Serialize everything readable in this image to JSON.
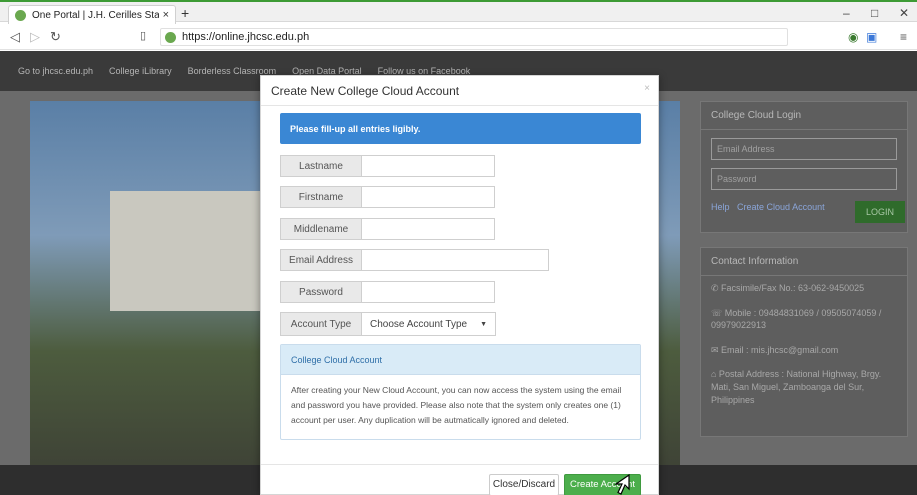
{
  "browser": {
    "tab_title": "One Portal | J.H. Cerilles State Colle",
    "tab_close": "×",
    "new_tab": "+",
    "window_minimize": "–",
    "window_restore": "□",
    "window_close": "✕",
    "url": "https://online.jhcsc.edu.ph"
  },
  "page": {
    "nav_links": [
      "Go to jhcsc.edu.ph",
      "College iLibrary",
      "Borderless Classroom",
      "Open Data Portal",
      "Follow us on Facebook"
    ],
    "login_title": "College Cloud Login",
    "login_email_placeholder": "Email Address",
    "login_password_placeholder": "Password",
    "login_help": "Help",
    "login_create": "Create Cloud Account",
    "login_button": "LOGIN",
    "contact_title": "Contact Information",
    "contact_lines": [
      "✆ Facsimile/Fax No.: 63-062-9450025",
      "☏ Mobile : 09484831069 / 09505074059 / 09979022913",
      "✉ Email : mis.jhcsc@gmail.com",
      "⌂ Postal Address : National Highway, Brgy. Mati, San Miguel, Zamboanga del Sur, Philippines"
    ]
  },
  "modal": {
    "title": "Create New College Cloud Account",
    "close_x": "×",
    "alert": "Please fill-up all entries ligibly.",
    "fields": {
      "lastname": "Lastname",
      "firstname": "Firstname",
      "middlename": "Middlename",
      "email": "Email Address",
      "password": "Password",
      "account_type": "Account Type"
    },
    "account_type_selected": "Choose Account Type",
    "info_title": "College Cloud Account",
    "info_body": "After creating your New Cloud Account, you can now access the system using the email and password you have provided. Please also note that the system only creates one (1) account per user. Any duplication will be autmatically ignored and deleted.",
    "btn_close": "Close/Discard",
    "btn_create": "Create Account"
  }
}
